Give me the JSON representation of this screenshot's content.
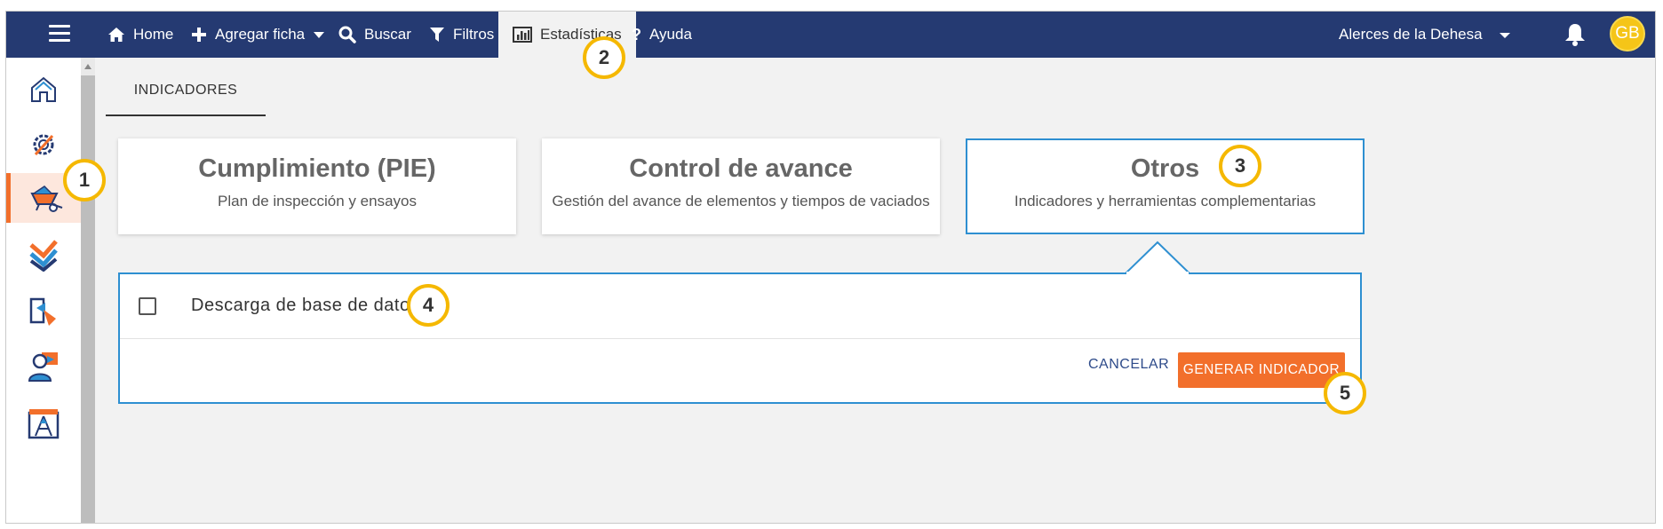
{
  "nav": {
    "menu_icon": "hamburger-icon",
    "items": [
      {
        "label": "Home",
        "icon": "home-icon"
      },
      {
        "label": "Agregar ficha",
        "icon": "plus-icon"
      },
      {
        "label": "Buscar",
        "icon": "search-icon"
      },
      {
        "label": "Filtros",
        "icon": "filter-icon"
      },
      {
        "label": "Estadísticas",
        "icon": "bar-chart-icon"
      },
      {
        "label": "Ayuda",
        "icon": "help-icon"
      }
    ],
    "active_item": "Estadísticas",
    "site_name": "Alerces de la Dehesa",
    "avatar_initials": "GB"
  },
  "sidebar": {
    "items": [
      {
        "icon": "home-outline-icon"
      },
      {
        "icon": "settings-pencil-icon"
      },
      {
        "icon": "wheelbarrow-icon",
        "active": true
      },
      {
        "icon": "checkmarks-icon"
      },
      {
        "icon": "document-arrow-icon"
      },
      {
        "icon": "user-card-icon"
      },
      {
        "icon": "blueprint-icon"
      }
    ]
  },
  "tabs": {
    "active": "INDICADORES"
  },
  "cards": [
    {
      "title": "Cumplimiento (PIE)",
      "subtitle": "Plan de inspección y ensayos"
    },
    {
      "title": "Control de avance",
      "subtitle": "Gestión del avance de elementos y tiempos de vaciados"
    },
    {
      "title": "Otros",
      "subtitle": "Indicadores y herramientas complementarias",
      "selected": true
    }
  ],
  "panel": {
    "option_label": "Descarga de base de datos",
    "checked": false,
    "cancel_label": "CANCELAR",
    "generate_label": "GENERAR INDICADOR"
  },
  "callouts": [
    "1",
    "2",
    "3",
    "4",
    "5"
  ],
  "colors": {
    "navbar": "#253a72",
    "accent": "#f26f2b",
    "selection": "#2e8fd1",
    "callout": "#f5b800"
  }
}
